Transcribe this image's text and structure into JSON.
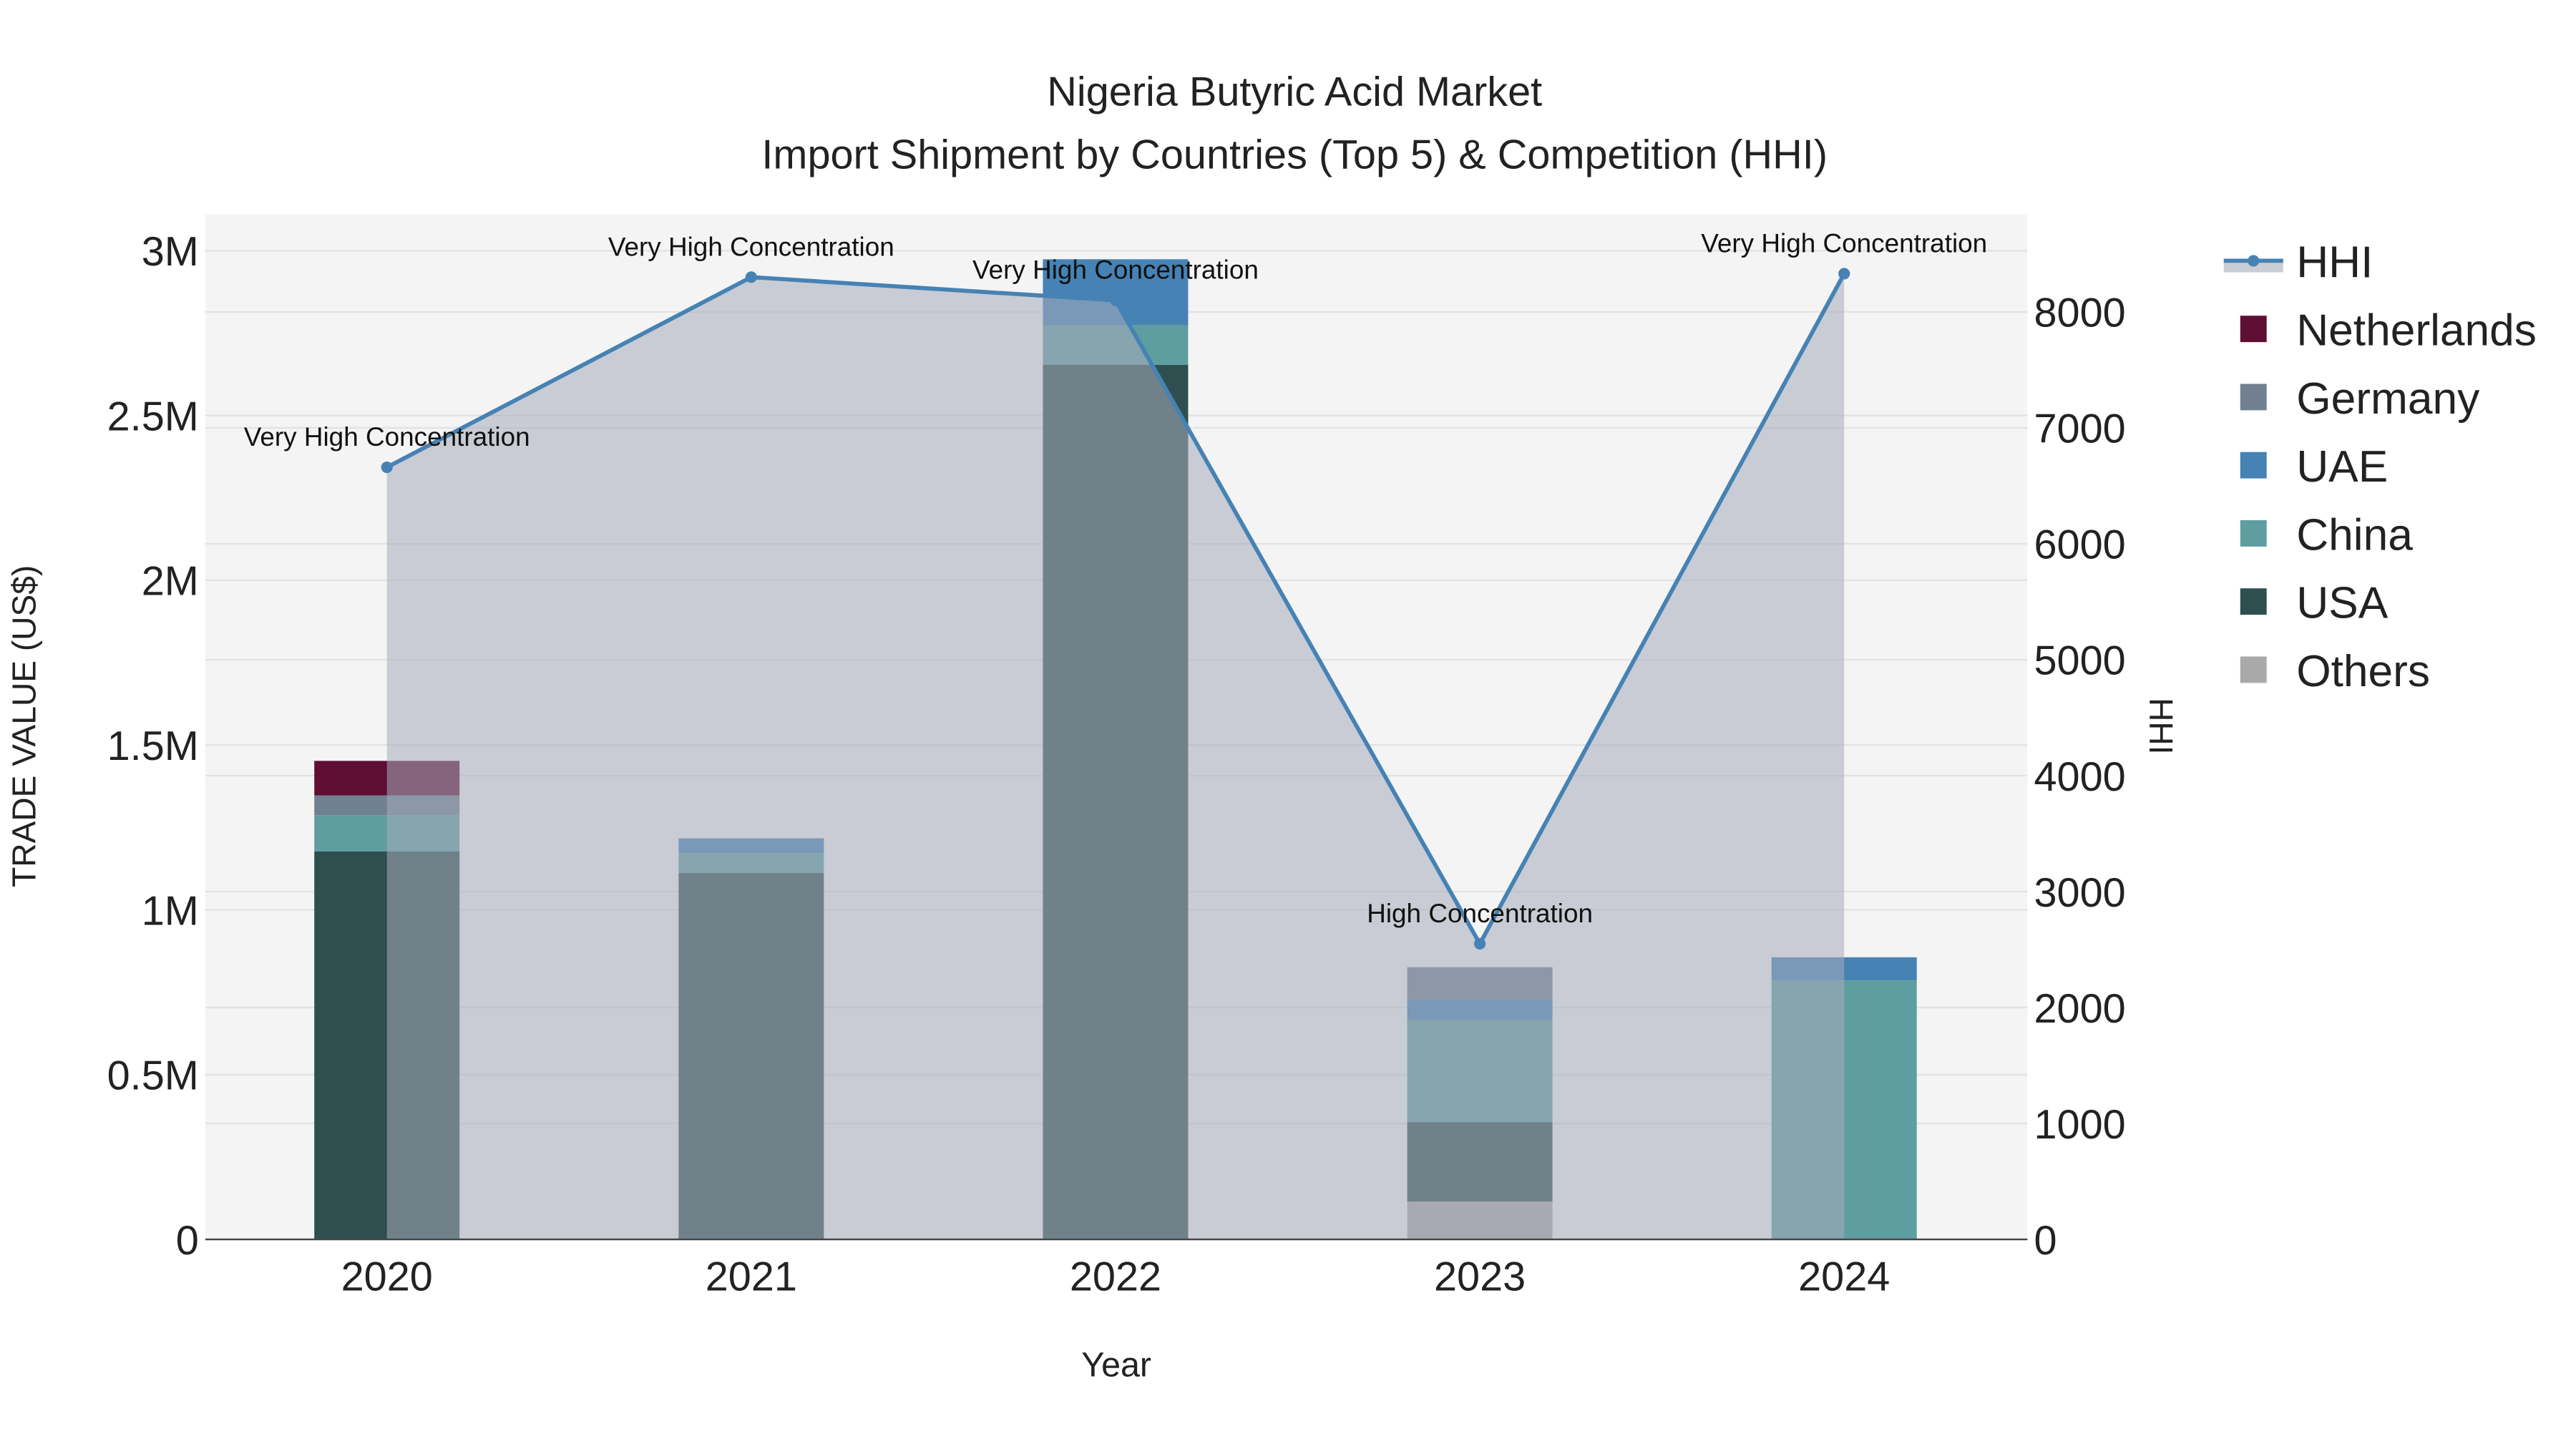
{
  "chart_data": {
    "type": "bar",
    "title": "Nigeria Butyric Acid Market",
    "subtitle": "Import Shipment by Countries (Top 5) & Competition (HHI)",
    "xlabel": "Year",
    "ylabel": "TRADE VALUE (US$)",
    "y2label": "HHI",
    "categories": [
      "2020",
      "2021",
      "2022",
      "2023",
      "2024"
    ],
    "ylim": [
      0,
      3100000
    ],
    "y2lim": [
      0,
      8800
    ],
    "yticks": [
      {
        "v": 0,
        "label": "0"
      },
      {
        "v": 500000,
        "label": "0.5M"
      },
      {
        "v": 1000000,
        "label": "1M"
      },
      {
        "v": 1500000,
        "label": "1.5M"
      },
      {
        "v": 2000000,
        "label": "2M"
      },
      {
        "v": 2500000,
        "label": "2.5M"
      },
      {
        "v": 3000000,
        "label": "3M"
      }
    ],
    "y2ticks": [
      0,
      1000,
      2000,
      3000,
      4000,
      5000,
      6000,
      7000,
      8000
    ],
    "stack_order": [
      "Others",
      "USA",
      "China",
      "UAE",
      "Germany",
      "Netherlands"
    ],
    "series": [
      {
        "name": "Netherlands",
        "color": "#5e0f33",
        "values": [
          105000,
          0,
          0,
          0,
          0
        ]
      },
      {
        "name": "Germany",
        "color": "#708090",
        "values": [
          60000,
          0,
          0,
          100000,
          0
        ]
      },
      {
        "name": "UAE",
        "color": "#4682b4",
        "values": [
          0,
          45000,
          200000,
          60000,
          70000
        ]
      },
      {
        "name": "China",
        "color": "#5f9ea0",
        "values": [
          110000,
          60000,
          120000,
          310000,
          786000
        ]
      },
      {
        "name": "USA",
        "color": "#2f4f4f",
        "values": [
          1177000,
          1112000,
          2654000,
          241000,
          0
        ]
      },
      {
        "name": "Others",
        "color": "#a9a9a9",
        "values": [
          0,
          0,
          0,
          115000,
          0
        ]
      }
    ],
    "hhi": {
      "name": "HHI",
      "color": "#4682b4",
      "values": [
        6660,
        8300,
        8100,
        2550,
        8330
      ],
      "annotations": [
        "Very High Concentration",
        "Very High Concentration",
        "Very High Concentration",
        "High Concentration",
        "Very High Concentration"
      ]
    },
    "legend": [
      "HHI",
      "Netherlands",
      "Germany",
      "UAE",
      "China",
      "USA",
      "Others"
    ],
    "legend_position": "right"
  }
}
